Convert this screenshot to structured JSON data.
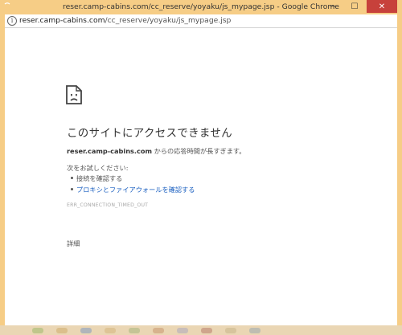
{
  "window": {
    "title": "reser.camp-cabins.com/cc_reserve/yoyaku/js_mypage.jsp - Google Chrome",
    "controls": {
      "minimize": "─",
      "maximize": "☐",
      "close": "✕"
    }
  },
  "omnibox": {
    "info_glyph": "i",
    "url_host": "reser.camp-cabins.com",
    "url_path": "/cc_reserve/yoyaku/js_mypage.jsp"
  },
  "error_page": {
    "icon": "sad-page-icon",
    "headline": "このサイトにアクセスできません",
    "host": "reser.camp-cabins.com",
    "description_suffix": " からの応答時間が長すぎます。",
    "try_label": "次をお試しください:",
    "suggestions": [
      "接続を確認する",
      "プロキシとファイアウォールを確認する"
    ],
    "error_code": "ERR_CONNECTION_TIMED_OUT",
    "details_button": "詳細"
  },
  "colors": {
    "window_frame": "#f6cd86",
    "link": "#1a5fc0",
    "close_button": "#c7413b"
  }
}
